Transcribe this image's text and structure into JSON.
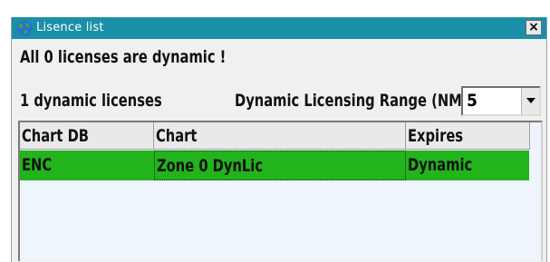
{
  "window": {
    "title": "Lisence list",
    "close_label": "×"
  },
  "summary_text": "All 0 licenses are dynamic !",
  "dynamic_count_text": "1 dynamic licenses",
  "range": {
    "label": "Dynamic Licensing Range (NM)",
    "value": "5"
  },
  "table": {
    "columns": [
      "Chart DB",
      "Chart",
      "Expires"
    ],
    "rows": [
      {
        "chart_db": "ENC",
        "chart": "Zone 0 DynLic",
        "expires": "Dynamic"
      }
    ]
  },
  "colors": {
    "titlebar": "#1a8fa7",
    "selected_row": "#22b31d",
    "list_bg": "#eef5fc"
  },
  "icons": {
    "title_icon": "globe-icon",
    "dropdown": "chevron-down-icon"
  }
}
